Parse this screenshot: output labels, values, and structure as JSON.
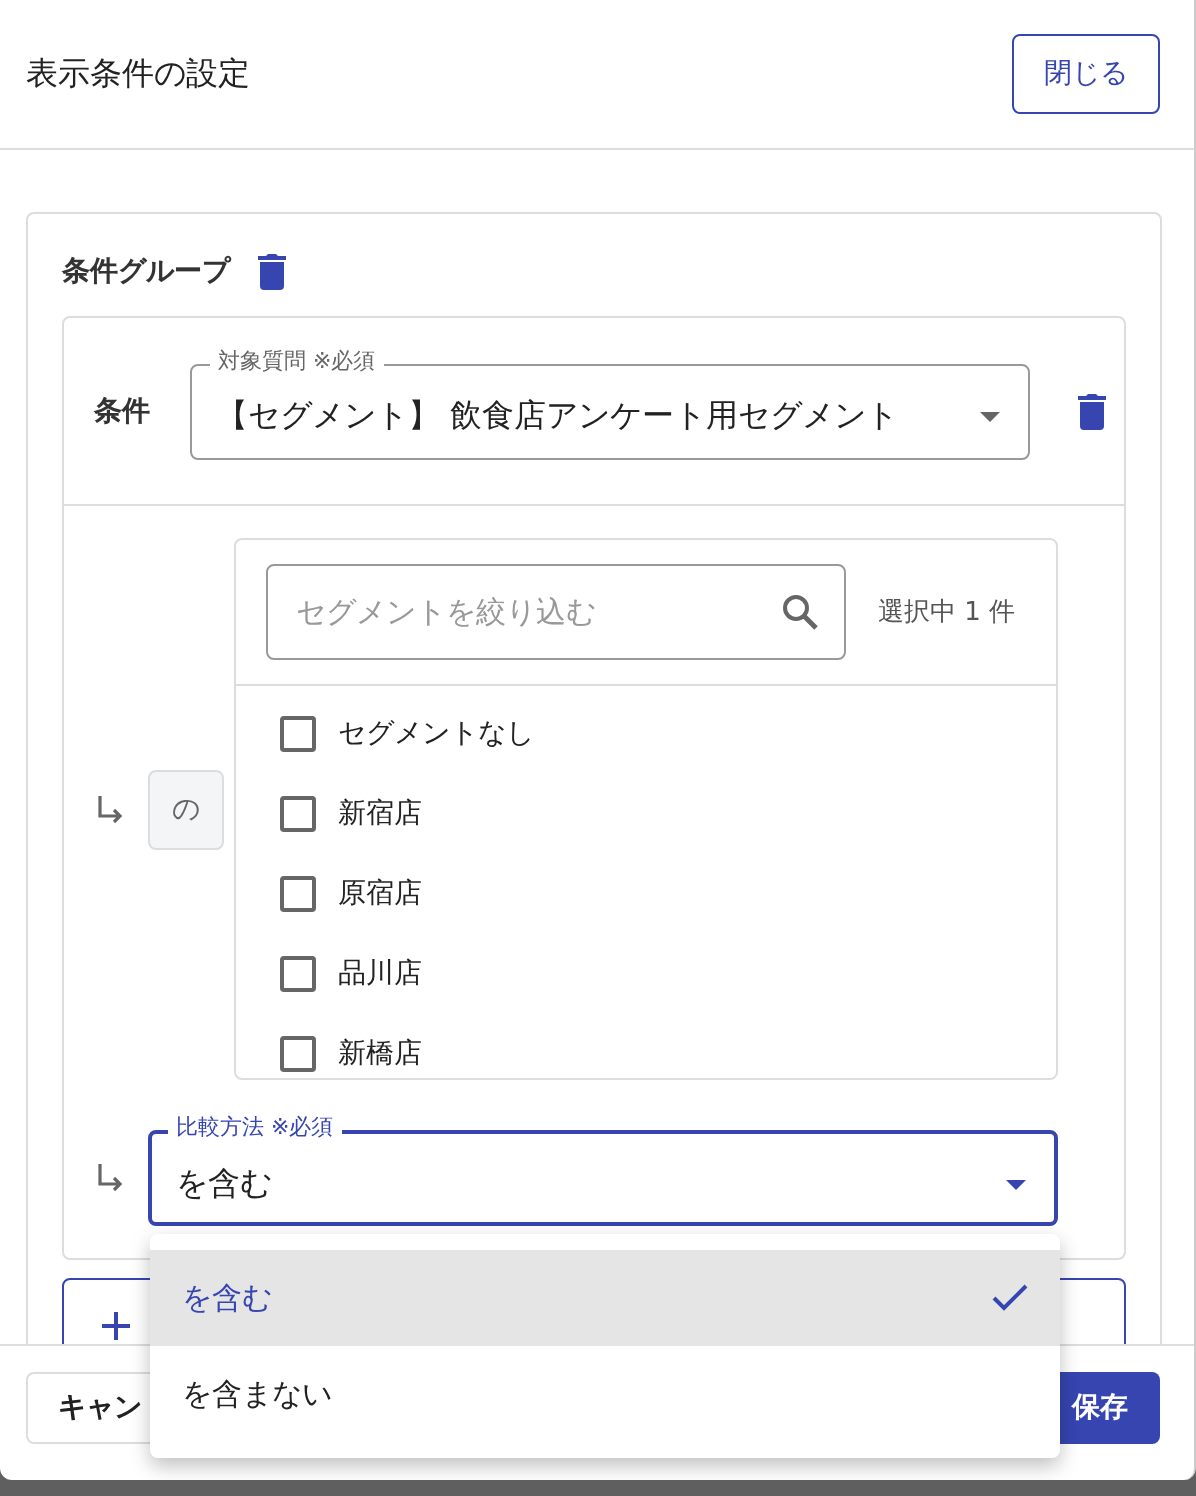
{
  "dialog": {
    "title": "表示条件の設定",
    "close_button": "閉じる"
  },
  "group": {
    "title": "条件グループ",
    "condition": {
      "label": "条件",
      "question_select": {
        "label": "対象質問 ※必須",
        "value": "【セグメント】 飲食店アンケート用セグメント"
      },
      "connector": "の",
      "segment_filter": {
        "placeholder": "セグメントを絞り込む",
        "selected_count": "選択中 1 件"
      },
      "segments": [
        {
          "label": "セグメントなし",
          "checked": false
        },
        {
          "label": "新宿店",
          "checked": false
        },
        {
          "label": "原宿店",
          "checked": false
        },
        {
          "label": "品川店",
          "checked": false
        },
        {
          "label": "新橋店",
          "checked": false
        }
      ],
      "compare_select": {
        "label": "比較方法 ※必須",
        "value": "を含む",
        "expanded": true,
        "options": [
          {
            "label": "を含む",
            "selected": true
          },
          {
            "label": "を含まない",
            "selected": false
          }
        ]
      }
    }
  },
  "footer": {
    "cancel_button": "キャン",
    "save_button": "保存"
  }
}
